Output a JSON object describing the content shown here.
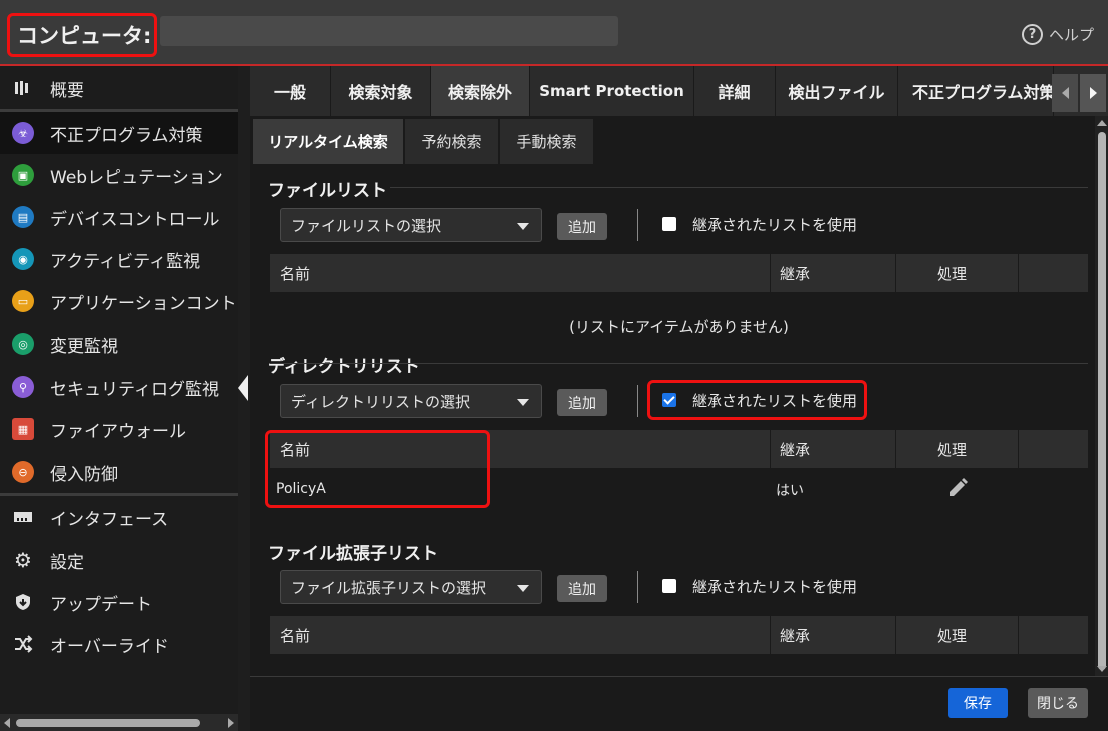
{
  "header": {
    "title": "コンピュータ:",
    "help_label": "ヘルプ",
    "help_glyph": "?"
  },
  "sidebar": {
    "items": [
      {
        "label": "概要",
        "icon": "overview-icon",
        "color": "#e0e0e0"
      },
      {
        "label": "不正プログラム対策",
        "icon": "antimalware-icon",
        "color": "#7b5cd6"
      },
      {
        "label": "Webレピュテーション",
        "icon": "web-reputation-icon",
        "color": "#2e9e3c"
      },
      {
        "label": "デバイスコントロール",
        "icon": "device-control-icon",
        "color": "#1f7ac2"
      },
      {
        "label": "アクティビティ監視",
        "icon": "activity-monitoring-icon",
        "color": "#1596b8"
      },
      {
        "label": "アプリケーションコントロール",
        "icon": "application-control-icon",
        "color": "#e8a019"
      },
      {
        "label": "変更監視",
        "icon": "integrity-monitoring-icon",
        "color": "#1a9e6a"
      },
      {
        "label": "セキュリティログ監視",
        "icon": "log-inspection-icon",
        "color": "#8a5dd6"
      },
      {
        "label": "ファイアウォール",
        "icon": "firewall-icon",
        "color": "#d84a3a"
      },
      {
        "label": "侵入防御",
        "icon": "intrusion-prevention-icon",
        "color": "#e06a2a"
      },
      {
        "label": "インタフェース",
        "icon": "interfaces-icon",
        "color": "#e0e0e0"
      },
      {
        "label": "設定",
        "icon": "settings-gear-icon",
        "color": "#e0e0e0"
      },
      {
        "label": "アップデート",
        "icon": "updates-icon",
        "color": "#e0e0e0"
      },
      {
        "label": "オーバーライド",
        "icon": "overrides-icon",
        "color": "#e0e0e0"
      }
    ]
  },
  "tabs": {
    "items": [
      "一般",
      "検索対象",
      "検索除外",
      "Smart Protection",
      "詳細",
      "検出ファイル",
      "不正プログラム対策"
    ],
    "active_index": 2
  },
  "subtabs": {
    "items": [
      "リアルタイム検索",
      "予約検索",
      "手動検索"
    ],
    "active_index": 0
  },
  "file_list": {
    "title": "ファイルリスト",
    "select": "ファイルリストの選択",
    "add": "追加",
    "inherit_label": "継承されたリストを使用",
    "inherit_checked": false,
    "columns": [
      "名前",
      "継承",
      "処理"
    ],
    "empty": "(リストにアイテムがありません)"
  },
  "directory_list": {
    "title": "ディレクトリリスト",
    "select": "ディレクトリリストの選択",
    "add": "追加",
    "inherit_label": "継承されたリストを使用",
    "inherit_checked": true,
    "columns": [
      "名前",
      "継承",
      "処理"
    ],
    "rows": [
      {
        "name": "PolicyA",
        "inherit": "はい"
      }
    ]
  },
  "extension_list": {
    "title": "ファイル拡張子リスト",
    "select": "ファイル拡張子リストの選択",
    "add": "追加",
    "inherit_label": "継承されたリストを使用",
    "inherit_checked": false,
    "columns": [
      "名前",
      "継承",
      "処理"
    ]
  },
  "footer": {
    "save": "保存",
    "close": "閉じる"
  },
  "colors": {
    "highlight": "#ee1111",
    "primary_button": "#1565d8",
    "accent_line": "#c62828"
  }
}
